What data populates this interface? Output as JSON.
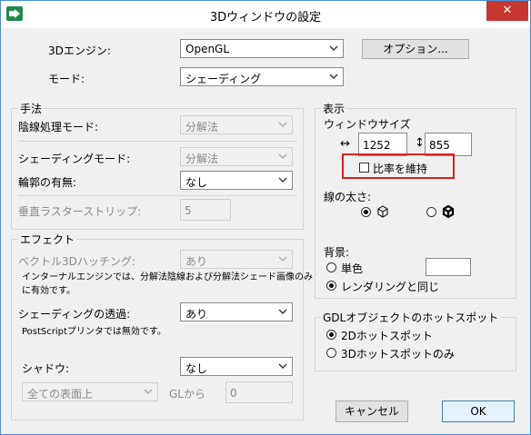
{
  "window": {
    "title": "3Dウィンドウの設定",
    "close_glyph": "✕"
  },
  "engine": {
    "label": "3Dエンジン:",
    "value": "OpenGL"
  },
  "options_button": "オプション...",
  "mode": {
    "label": "モード:",
    "value": "シェーディング"
  },
  "method": {
    "title": "手法",
    "hidden_line_label": "陰線処理モード:",
    "hidden_line_value": "分解法",
    "shading_label": "シェーディングモード:",
    "shading_value": "分解法",
    "contour_label": "輪郭の有無:",
    "contour_value": "なし",
    "raster_label": "垂直ラスターストリップ:",
    "raster_value": "5"
  },
  "effects": {
    "title": "エフェクト",
    "vector_hatch_label": "ベクトル3Dハッチング:",
    "vector_hatch_value": "あり",
    "vector_note_1": "インターナルエンジンでは、分解法陰線および分解法シェード画像のみ",
    "vector_note_2": "に有効です。",
    "transparency_label": "シェーディングの透過:",
    "transparency_value": "あり",
    "postscript_note": "PostScriptプリンタでは無効です。",
    "shadow_label": "シャドウ:",
    "shadow_value": "なし",
    "surface_value": "全ての表面上",
    "gl_label": "GLから",
    "gl_value": "0"
  },
  "display": {
    "title": "表示",
    "window_size_label": "ウィンドウサイズ",
    "width_icon": "↔",
    "width": "1252",
    "height_icon": "↕",
    "height": "855",
    "keep_ratio": "比率を維持",
    "line_width_label": "線の太さ:",
    "background_label": "背景:",
    "bg_solid": "単色",
    "bg_same": "レンダリングと同じ"
  },
  "gdl": {
    "title": "GDLオブジェクトのホットスポット",
    "opt_2d": "2Dホットスポット",
    "opt_3d": "3Dホットスポットのみ"
  },
  "cancel_button": "キャンセル",
  "ok_button": "OK",
  "colors": {
    "highlight_border": "#d92020",
    "title_close": "#c7372f",
    "app_icon": "#1e8a4c"
  }
}
